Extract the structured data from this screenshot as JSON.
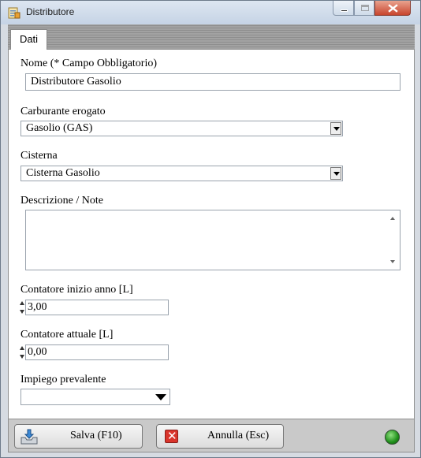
{
  "window": {
    "title": "Distributore",
    "icon": "form-document-icon",
    "controls": [
      "minimize-icon",
      "maximize-icon",
      "close-icon"
    ]
  },
  "tabs": [
    {
      "label": "Dati",
      "active": true
    }
  ],
  "form": {
    "nome": {
      "label": "Nome (* Campo Obbligatorio)",
      "value": "Distributore Gasolio"
    },
    "carburante": {
      "label": "Carburante erogato",
      "value": "Gasolio (GAS)"
    },
    "cisterna": {
      "label": "Cisterna",
      "value": "Cisterna Gasolio"
    },
    "descrizione": {
      "label": "Descrizione / Note",
      "value": ""
    },
    "contatore_inizio": {
      "label": "Contatore inizio anno [L]",
      "value": "3,00"
    },
    "contatore_attuale": {
      "label": "Contatore attuale [L]",
      "value": "0,00"
    },
    "impiego": {
      "label": "Impiego prevalente",
      "value": ""
    }
  },
  "footer": {
    "save_label": "Salva (F10)",
    "cancel_label": "Annulla (Esc)",
    "status_color": "#1f8f1a"
  }
}
